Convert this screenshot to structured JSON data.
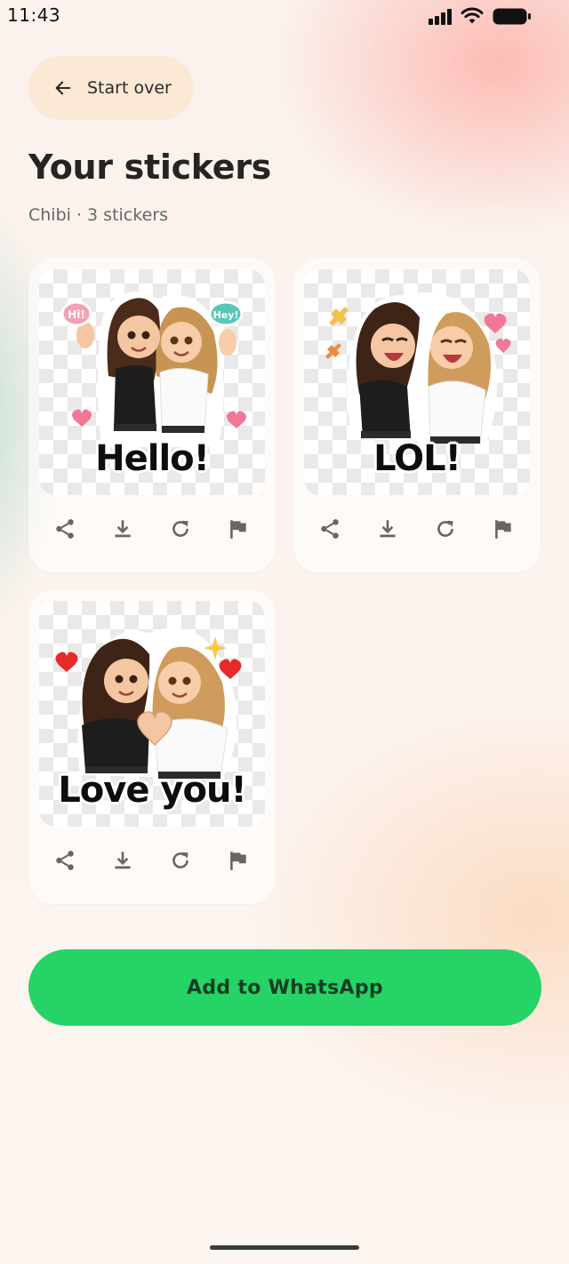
{
  "status_bar": {
    "time": "11:43"
  },
  "header": {
    "start_over_label": "Start over",
    "title": "Your stickers",
    "subtitle": "Chibi · 3 stickers"
  },
  "stickers": [
    {
      "caption": "Hello!"
    },
    {
      "caption": "LOL!"
    },
    {
      "caption": "Love you!"
    }
  ],
  "sticker_actions": [
    "share-icon",
    "download-icon",
    "refresh-icon",
    "flag-icon"
  ],
  "primary_action": {
    "label": "Add to WhatsApp"
  },
  "colors": {
    "start_over_bg": "#fbe8d5",
    "whatsapp_green": "#25d366",
    "title_text": "#262320",
    "subtitle_text": "#6c6663",
    "icon": "#6b6460"
  }
}
